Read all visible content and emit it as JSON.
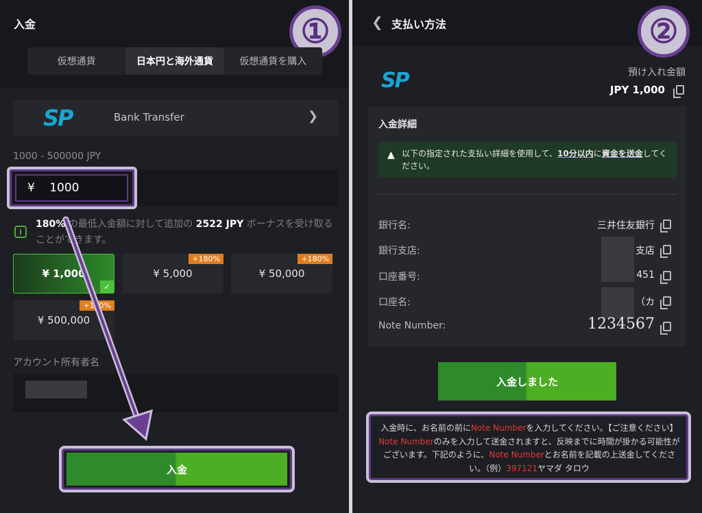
{
  "left": {
    "title": "入金",
    "badge": "①",
    "tabs": [
      {
        "label": "仮想通貨",
        "active": false
      },
      {
        "label": "日本円と海外通貨",
        "active": true
      },
      {
        "label": "仮想通貨を購入",
        "active": false
      }
    ],
    "method": {
      "logo": "SP",
      "label": "Bank Transfer"
    },
    "range": "1000 - 500000 JPY",
    "amount": {
      "currency": "¥",
      "value": "1000"
    },
    "bonus": {
      "percent": "180%",
      "text1": "の最低入金額に対して追加の",
      "amount": "2522 JPY",
      "text2": "ボーナスを受け取ることができます。"
    },
    "chips": [
      {
        "label": "¥ 1,000",
        "tag": "",
        "selected": true
      },
      {
        "label": "¥ 5,000",
        "tag": "+180%",
        "selected": false
      },
      {
        "label": "¥ 50,000",
        "tag": "+180%",
        "selected": false
      },
      {
        "label": "¥ 500,000",
        "tag": "+180%",
        "selected": false
      }
    ],
    "owner_label": "アカウント所有者名",
    "deposit_button": "入金"
  },
  "right": {
    "title": "支払い方法",
    "badge": "②",
    "logo": "SP",
    "deposit_label": "預け入れ金額",
    "deposit_amount": "JPY 1,000",
    "details_title": "入金詳細",
    "warning": {
      "pre": "以下の指定された支払い詳細を使用して、",
      "emph1": "10分以内",
      "mid": "に",
      "emph2": "資金を送金",
      "post": "してください。"
    },
    "rows": [
      {
        "label": "銀行名:",
        "value": "三井住友銀行"
      },
      {
        "label": "銀行支店:",
        "value": "支店"
      },
      {
        "label": "口座番号:",
        "value": "451"
      },
      {
        "label": "口座名:",
        "value": "（カ"
      },
      {
        "label": "Note Number:",
        "value": "1234567"
      }
    ],
    "done_button": "入金しました",
    "notice": {
      "p1": "入金時に、お名前の前に",
      "nn1": "Note Number",
      "p2": "を入力してください。【ご注意ください】",
      "nn2": "Note Number",
      "p3": "のみを入力して送金されますと、反映までに時間が掛かる可能性がございます。下記のように、",
      "nn3": "Note Number",
      "p4": "とお名前を記載の上送金してください。（例）",
      "example_num": "397121",
      "example_name": "ヤマダ タロウ"
    }
  },
  "colors": {
    "accent_green": "#4cae22",
    "highlight_purple": "#5b3a86",
    "orange_tag": "#e07d1d",
    "red_text": "#e03a34"
  }
}
